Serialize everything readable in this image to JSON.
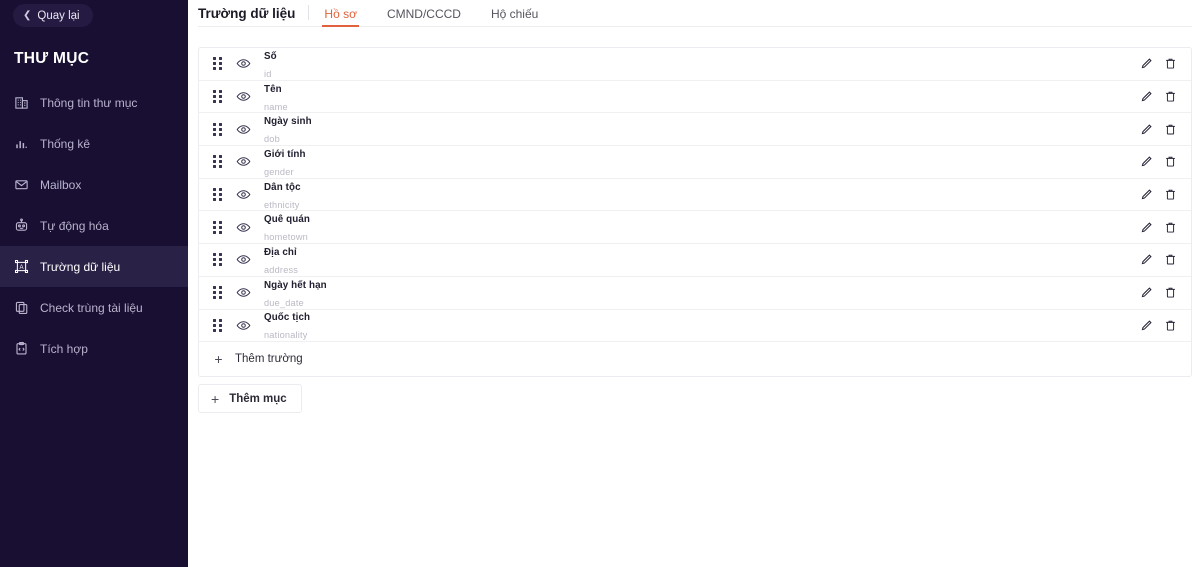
{
  "sidebar": {
    "back_button": {
      "label": "Quay lại",
      "icon": "chevron-left-icon"
    },
    "title": "THƯ MỤC",
    "items": [
      {
        "label": "Thông tin thư mục",
        "icon": "building-icon",
        "active": false
      },
      {
        "label": "Thống kê",
        "icon": "bar-chart-icon",
        "active": false
      },
      {
        "label": "Mailbox",
        "icon": "envelope-icon",
        "active": false
      },
      {
        "label": "Tự động hóa",
        "icon": "robot-icon",
        "active": false
      },
      {
        "label": "Trường dữ liệu",
        "icon": "data-field-icon",
        "active": true
      },
      {
        "label": "Check trùng tài liệu",
        "icon": "copy-icon",
        "active": false
      },
      {
        "label": "Tích hợp",
        "icon": "clipboard-code-icon",
        "active": false
      }
    ],
    "background_color": "#180f33",
    "active_item_color": "#2a2147"
  },
  "main": {
    "section_title": "Trường dữ liệu",
    "tabs": [
      {
        "label": "Hồ sơ",
        "active": true
      },
      {
        "label": "CMND/CCCD",
        "active": false
      },
      {
        "label": "Hộ chiếu",
        "active": false
      }
    ],
    "accent_color": "#e0613b",
    "fields": [
      {
        "label": "Số",
        "key": "id"
      },
      {
        "label": "Tên",
        "key": "name"
      },
      {
        "label": "Ngày sinh",
        "key": "dob"
      },
      {
        "label": "Giới tính",
        "key": "gender"
      },
      {
        "label": "Dân tộc",
        "key": "ethnicity"
      },
      {
        "label": "Quê quán",
        "key": "hometown"
      },
      {
        "label": "Địa chỉ",
        "key": "address"
      },
      {
        "label": "Ngày hết hạn",
        "key": "due_date"
      },
      {
        "label": "Quốc tịch",
        "key": "nationality"
      }
    ],
    "row_icons": {
      "drag": "drag-handle-icon",
      "visibility": "eye-icon",
      "edit": "pencil-icon",
      "delete": "trash-icon"
    },
    "add_field_button": {
      "label": "Thêm trường",
      "icon": "plus-icon"
    },
    "add_section_button": {
      "label": "Thêm mục",
      "icon": "plus-icon"
    }
  }
}
